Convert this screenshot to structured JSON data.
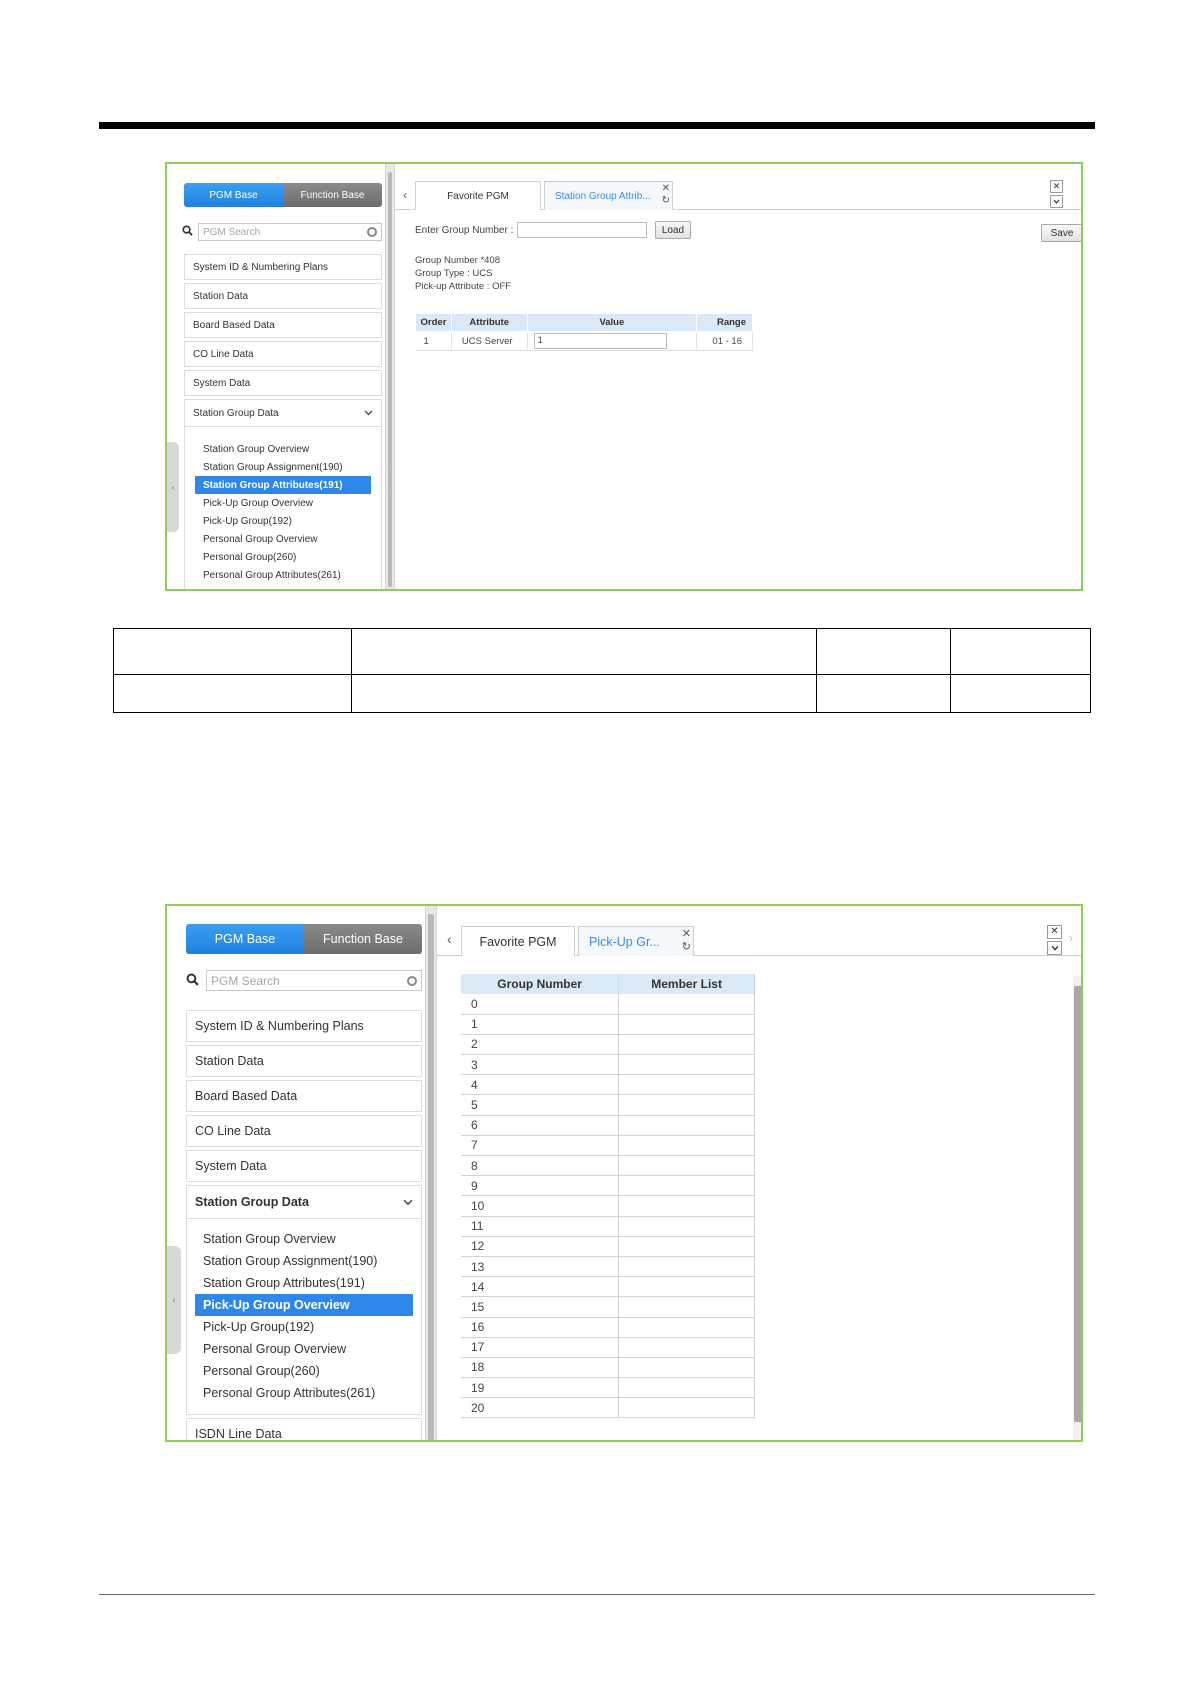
{
  "shot1": {
    "nav": {
      "pgm_base": "PGM Base",
      "function_base": "Function Base",
      "search_placeholder": "PGM Search"
    },
    "menu": [
      "System ID & Numbering Plans",
      "Station Data",
      "Board Based Data",
      "CO Line Data",
      "System Data",
      "Station Group Data"
    ],
    "submenu": [
      "Station Group Overview",
      "Station Group Assignment(190)",
      "Station Group Attributes(191)",
      "Pick-Up Group Overview",
      "Pick-Up Group(192)",
      "Personal Group Overview",
      "Personal Group(260)",
      "Personal Group Attributes(261)"
    ],
    "selected_submenu": "Station Group Attributes(191)",
    "tabs": {
      "favorite": "Favorite PGM",
      "active": "Station Group Attrib..."
    },
    "form": {
      "group_label": "Enter Group Number :",
      "group_value": "",
      "load": "Load",
      "save": "Save",
      "info": [
        "Group Number *408",
        "Group Type : UCS",
        "Pick-up Attribute : OFF"
      ]
    },
    "table": {
      "headers": [
        "Order",
        "Attribute",
        "Value",
        "Range"
      ],
      "row": {
        "order": "1",
        "attribute": "UCS Server",
        "value": "1",
        "range": "01 - 16"
      }
    }
  },
  "shot2": {
    "nav": {
      "pgm_base": "PGM Base",
      "function_base": "Function Base",
      "search_placeholder": "PGM Search"
    },
    "menu": [
      "System ID & Numbering Plans",
      "Station Data",
      "Board Based Data",
      "CO Line Data",
      "System Data",
      "Station Group Data"
    ],
    "submenu": [
      "Station Group Overview",
      "Station Group Assignment(190)",
      "Station Group Attributes(191)",
      "Pick-Up Group Overview",
      "Pick-Up Group(192)",
      "Personal Group Overview",
      "Personal Group(260)",
      "Personal Group Attributes(261)"
    ],
    "selected_submenu": "Pick-Up Group Overview",
    "last_menu": "ISDN Line Data",
    "tabs": {
      "favorite": "Favorite PGM",
      "active": "Pick-Up Gr..."
    },
    "table": {
      "headers": [
        "Group Number",
        "Member List"
      ],
      "rows": [
        "0",
        "1",
        "2",
        "3",
        "4",
        "5",
        "6",
        "7",
        "8",
        "9",
        "10",
        "11",
        "12",
        "13",
        "14",
        "15",
        "16",
        "17",
        "18",
        "19",
        "20"
      ]
    }
  },
  "icons": {
    "search": "search-icon",
    "close": "close-icon",
    "refresh": "refresh-icon",
    "chevron_down": "chevron-down-icon",
    "chevron_left": "chevron-left-icon"
  }
}
